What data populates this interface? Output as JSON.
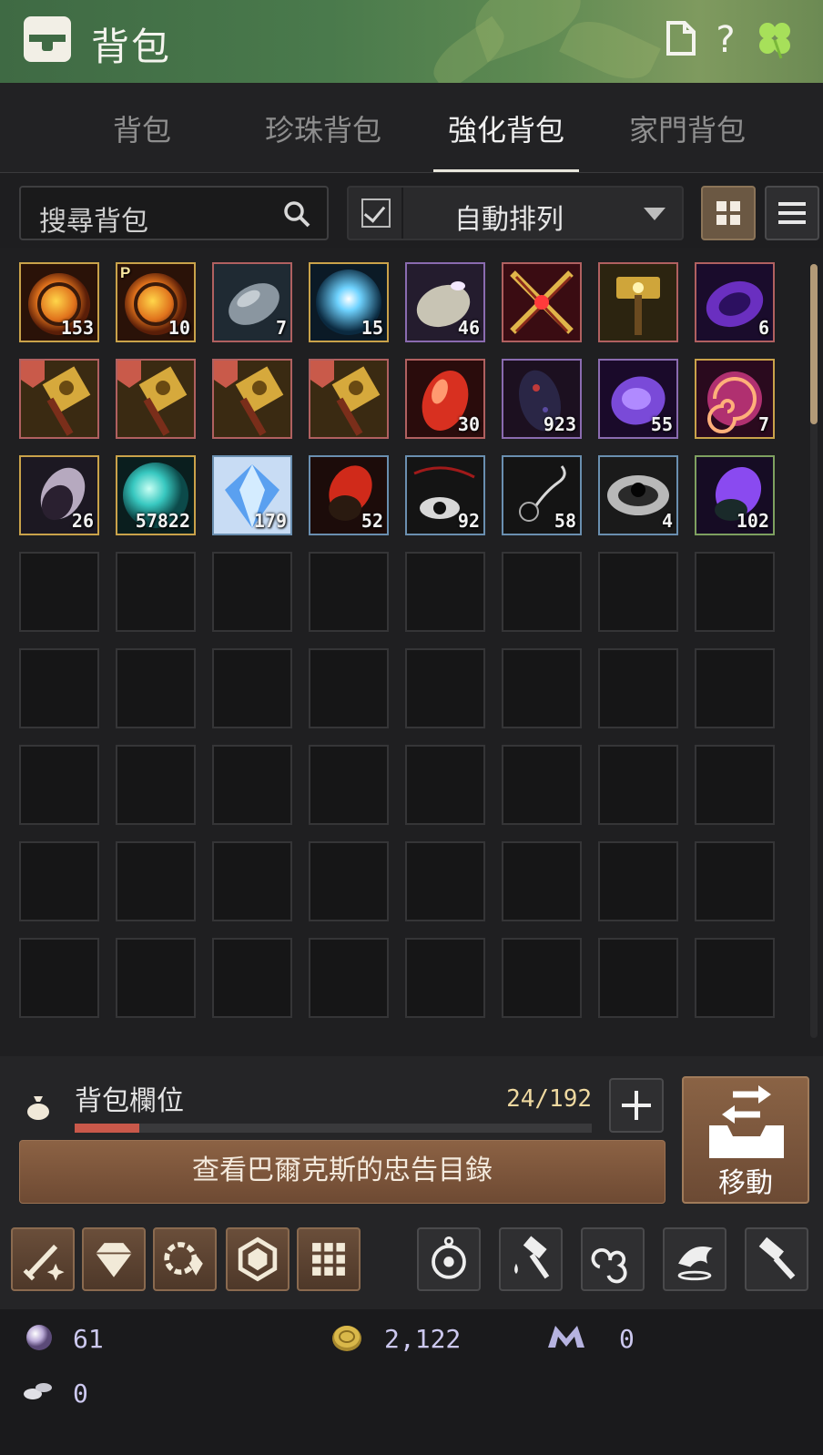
{
  "window": {
    "title": "背包"
  },
  "tabs": [
    {
      "label": "背包",
      "active": false
    },
    {
      "label": "珍珠背包",
      "active": false
    },
    {
      "label": "強化背包",
      "active": true
    },
    {
      "label": "家門背包",
      "active": false
    }
  ],
  "toolbar": {
    "search_placeholder": "搜尋背包",
    "auto_sort_label": "自動排列",
    "auto_sort_checked": true
  },
  "inventory": {
    "items": [
      {
        "icon": "fire-orb-icon",
        "count": "153",
        "border": "#c9a24a",
        "tag": ""
      },
      {
        "icon": "fire-orb-icon",
        "count": "10",
        "border": "#c9a24a",
        "tag": "P"
      },
      {
        "icon": "gray-stone-icon",
        "count": "7",
        "border": "#b06060",
        "tag": ""
      },
      {
        "icon": "blue-glow-stone-icon",
        "count": "15",
        "border": "#c9a24a",
        "tag": ""
      },
      {
        "icon": "silver-stone-icon",
        "count": "46",
        "border": "#8a6bb0",
        "tag": ""
      },
      {
        "icon": "crossed-swords-icon",
        "count": "",
        "border": "#b06060",
        "tag": ""
      },
      {
        "icon": "gold-hammer-icon",
        "count": "",
        "border": "#b06060",
        "tag": ""
      },
      {
        "icon": "purple-stone-icon",
        "count": "6",
        "border": "#b06060",
        "tag": ""
      },
      {
        "icon": "gold-hammer-scroll-icon",
        "count": "",
        "border": "#b06060",
        "tag": "sword"
      },
      {
        "icon": "gold-hammer-scroll-icon",
        "count": "",
        "border": "#b06060",
        "tag": "sword"
      },
      {
        "icon": "gold-hammer-scroll-icon",
        "count": "",
        "border": "#b06060",
        "tag": "sword"
      },
      {
        "icon": "gold-hammer-scroll-icon",
        "count": "",
        "border": "#b06060",
        "tag": "sword"
      },
      {
        "icon": "red-crystal-icon",
        "count": "30",
        "border": "#b06060",
        "tag": ""
      },
      {
        "icon": "dark-crystal-icon",
        "count": "923",
        "border": "#8a6bb0",
        "tag": ""
      },
      {
        "icon": "violet-stone-icon",
        "count": "55",
        "border": "#8a6bb0",
        "tag": ""
      },
      {
        "icon": "galaxy-swirl-icon",
        "count": "7",
        "border": "#c9a24a",
        "tag": ""
      },
      {
        "icon": "shadow-shard-icon",
        "count": "26",
        "border": "#c9a24a",
        "tag": ""
      },
      {
        "icon": "cyan-orb-icon",
        "count": "57822",
        "border": "#c9a24a",
        "tag": ""
      },
      {
        "icon": "blue-gem-icon",
        "count": "179",
        "border": "#6a8fb0",
        "tag": ""
      },
      {
        "icon": "red-shard-icon",
        "count": "52",
        "border": "#6a8fb0",
        "tag": ""
      },
      {
        "icon": "eye-necklace-icon",
        "count": "92",
        "border": "#6a8fb0",
        "tag": ""
      },
      {
        "icon": "black-earring-icon",
        "count": "58",
        "border": "#6a8fb0",
        "tag": ""
      },
      {
        "icon": "black-ring-icon",
        "count": "4",
        "border": "#6a8fb0",
        "tag": ""
      },
      {
        "icon": "violet-shard-icon",
        "count": "102",
        "border": "#7ea060",
        "tag": ""
      }
    ],
    "empty_slots": 40
  },
  "capacity": {
    "label": "背包欄位",
    "count_text": "24/192",
    "fill_fraction": 0.125
  },
  "advice_button": "查看巴爾克斯的忠告目錄",
  "move_button": "移動",
  "quick_buttons_left": [
    "sword-sparkle-icon",
    "diamond-icon",
    "cycle-shard-icon",
    "hex-gem-icon",
    "grid-icon"
  ],
  "quick_buttons_right": [
    "compass-icon",
    "hammer-drop-icon",
    "swirl-icon",
    "dolphin-icon",
    "hammer-icon"
  ],
  "currency": {
    "pearl": "61",
    "silver": "2,122",
    "mileage": "0",
    "crow_coin": "0"
  },
  "colors": {
    "title_green": "#4a7a4c",
    "accent_brown": "#8c6244",
    "capacity_red": "#c9584a"
  }
}
